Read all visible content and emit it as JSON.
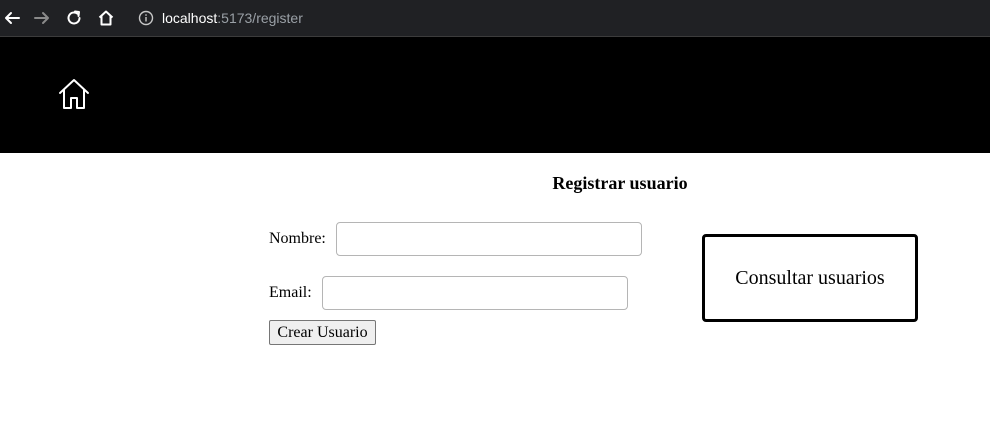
{
  "browser": {
    "url_host": "localhost",
    "url_rest": ":5173/register",
    "icons": [
      "arrow-left-icon",
      "arrow-right-icon",
      "reload-icon",
      "home-icon",
      "info-icon"
    ]
  },
  "header": {
    "home_icon": "home-icon",
    "background": "#000000"
  },
  "form": {
    "title": "Registrar usuario",
    "nombre_label": "Nombre:",
    "nombre_value": "",
    "email_label": "Email:",
    "email_value": "",
    "submit_label": "Crear Usuario"
  },
  "consult": {
    "label": "Consultar usuarios"
  }
}
